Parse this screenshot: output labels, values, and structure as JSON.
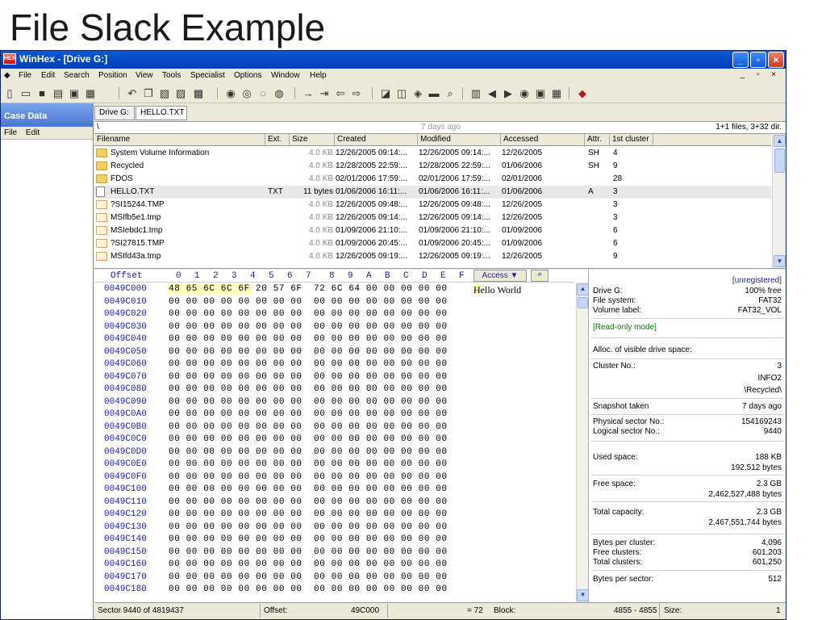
{
  "slide": {
    "title": "File Slack Example"
  },
  "window": {
    "title": "WinHex - [Drive G:]",
    "menu": [
      "File",
      "Edit",
      "Search",
      "Position",
      "View",
      "Tools",
      "Specialist",
      "Options",
      "Window",
      "Help"
    ],
    "mdi_controls": "_ ▫ ×"
  },
  "case_pane": {
    "title": "Case Data",
    "menu": [
      "File",
      "Edit"
    ]
  },
  "tabs": [
    "Drive G:",
    "HELLO.TXT"
  ],
  "path_bar": {
    "path": "\\",
    "age": "7 days ago",
    "summary": "1+1 files, 3+32 dir."
  },
  "file_table": {
    "columns": [
      "Filename",
      "Ext.",
      "Size",
      "Created",
      "Modified",
      "Accessed",
      "Attr.",
      "1st cluster"
    ],
    "rows": [
      {
        "name": "System Volume Information",
        "ext": "",
        "size": "4.0 KB",
        "created": "12/26/2005 09:14:...",
        "modified": "12/26/2005 09:14:...",
        "accessed": "12/26/2005",
        "attr": "SH",
        "cluster": "4",
        "icon": "folder"
      },
      {
        "name": "Recycled",
        "ext": "",
        "size": "4.0 KB",
        "created": "12/28/2005 22:59:...",
        "modified": "12/28/2005 22:59:...",
        "accessed": "01/06/2006",
        "attr": "SH",
        "cluster": "9",
        "icon": "folder"
      },
      {
        "name": "FDOS",
        "ext": "",
        "size": "4.0 KB",
        "created": "02/01/2006 17:59:...",
        "modified": "02/01/2006 17:59:...",
        "accessed": "02/01/2006",
        "attr": "",
        "cluster": "28",
        "icon": "folder"
      },
      {
        "name": "HELLO.TXT",
        "ext": "TXT",
        "size": "11 bytes",
        "created": "01/06/2006 16:11:...",
        "modified": "01/06/2006 16:11:...",
        "accessed": "01/06/2006",
        "attr": "A",
        "cluster": "3",
        "icon": "doc"
      },
      {
        "name": "?SI15244.TMP",
        "ext": "",
        "size": "4.0 KB",
        "created": "12/26/2005 09:48:...",
        "modified": "12/26/2005 09:48:...",
        "accessed": "12/26/2005",
        "attr": "",
        "cluster": "3",
        "icon": "tmp"
      },
      {
        "name": "MSIfb5e1.tmp",
        "ext": "",
        "size": "4.0 KB",
        "created": "12/26/2005 09:14:...",
        "modified": "12/26/2005 09:14:...",
        "accessed": "12/26/2005",
        "attr": "",
        "cluster": "3",
        "icon": "tmp"
      },
      {
        "name": "MSIebdc1.tmp",
        "ext": "",
        "size": "4.0 KB",
        "created": "01/09/2006 21:10:...",
        "modified": "01/09/2006 21:10:...",
        "accessed": "01/09/2006",
        "attr": "",
        "cluster": "6",
        "icon": "tmp"
      },
      {
        "name": "?SI27815.TMP",
        "ext": "",
        "size": "4.0 KB",
        "created": "01/09/2006 20:45:...",
        "modified": "01/09/2006 20:45:...",
        "accessed": "01/09/2006",
        "attr": "",
        "cluster": "6",
        "icon": "tmp"
      },
      {
        "name": "MSIfd43a.tmp",
        "ext": "",
        "size": "4.0 KB",
        "created": "12/26/2005 09:19:...",
        "modified": "12/26/2005 09:19:...",
        "accessed": "12/26/2005",
        "attr": "",
        "cluster": "9",
        "icon": "tmp"
      }
    ]
  },
  "hex_view": {
    "offset_label": "Offset",
    "column_headers": [
      "0",
      "1",
      "2",
      "3",
      "4",
      "5",
      "6",
      "7",
      "8",
      "9",
      "A",
      "B",
      "C",
      "D",
      "E",
      "F"
    ],
    "access_label": "Access ▼",
    "rows": [
      {
        "offset": "0049C000",
        "bytes": "48 65 6C 6C 6F 20 57 6F  72 6C 64 00 00 00 00 00",
        "ascii": "Hello World"
      },
      {
        "offset": "0049C010",
        "bytes": "00 00 00 00 00 00 00 00  00 00 00 00 00 00 00 00",
        "ascii": ""
      },
      {
        "offset": "0049C020",
        "bytes": "00 00 00 00 00 00 00 00  00 00 00 00 00 00 00 00",
        "ascii": ""
      },
      {
        "offset": "0049C030",
        "bytes": "00 00 00 00 00 00 00 00  00 00 00 00 00 00 00 00",
        "ascii": ""
      },
      {
        "offset": "0049C040",
        "bytes": "00 00 00 00 00 00 00 00  00 00 00 00 00 00 00 00",
        "ascii": ""
      },
      {
        "offset": "0049C050",
        "bytes": "00 00 00 00 00 00 00 00  00 00 00 00 00 00 00 00",
        "ascii": ""
      },
      {
        "offset": "0049C060",
        "bytes": "00 00 00 00 00 00 00 00  00 00 00 00 00 00 00 00",
        "ascii": ""
      },
      {
        "offset": "0049C070",
        "bytes": "00 00 00 00 00 00 00 00  00 00 00 00 00 00 00 00",
        "ascii": ""
      },
      {
        "offset": "0049C080",
        "bytes": "00 00 00 00 00 00 00 00  00 00 00 00 00 00 00 00",
        "ascii": ""
      },
      {
        "offset": "0049C090",
        "bytes": "00 00 00 00 00 00 00 00  00 00 00 00 00 00 00 00",
        "ascii": ""
      },
      {
        "offset": "0049C0A0",
        "bytes": "00 00 00 00 00 00 00 00  00 00 00 00 00 00 00 00",
        "ascii": ""
      },
      {
        "offset": "0049C0B0",
        "bytes": "00 00 00 00 00 00 00 00  00 00 00 00 00 00 00 00",
        "ascii": ""
      },
      {
        "offset": "0049C0C0",
        "bytes": "00 00 00 00 00 00 00 00  00 00 00 00 00 00 00 00",
        "ascii": ""
      },
      {
        "offset": "0049C0D0",
        "bytes": "00 00 00 00 00 00 00 00  00 00 00 00 00 00 00 00",
        "ascii": ""
      },
      {
        "offset": "0049C0E0",
        "bytes": "00 00 00 00 00 00 00 00  00 00 00 00 00 00 00 00",
        "ascii": ""
      },
      {
        "offset": "0049C0F0",
        "bytes": "00 00 00 00 00 00 00 00  00 00 00 00 00 00 00 00",
        "ascii": ""
      },
      {
        "offset": "0049C100",
        "bytes": "00 00 00 00 00 00 00 00  00 00 00 00 00 00 00 00",
        "ascii": ""
      },
      {
        "offset": "0049C110",
        "bytes": "00 00 00 00 00 00 00 00  00 00 00 00 00 00 00 00",
        "ascii": ""
      },
      {
        "offset": "0049C120",
        "bytes": "00 00 00 00 00 00 00 00  00 00 00 00 00 00 00 00",
        "ascii": ""
      },
      {
        "offset": "0049C130",
        "bytes": "00 00 00 00 00 00 00 00  00 00 00 00 00 00 00 00",
        "ascii": ""
      },
      {
        "offset": "0049C140",
        "bytes": "00 00 00 00 00 00 00 00  00 00 00 00 00 00 00 00",
        "ascii": ""
      },
      {
        "offset": "0049C150",
        "bytes": "00 00 00 00 00 00 00 00  00 00 00 00 00 00 00 00",
        "ascii": ""
      },
      {
        "offset": "0049C160",
        "bytes": "00 00 00 00 00 00 00 00  00 00 00 00 00 00 00 00",
        "ascii": ""
      },
      {
        "offset": "0049C170",
        "bytes": "00 00 00 00 00 00 00 00  00 00 00 00 00 00 00 00",
        "ascii": ""
      },
      {
        "offset": "0049C180",
        "bytes": "00 00 00 00 00 00 00 00  00 00 00 00 00 00 00 00",
        "ascii": ""
      }
    ]
  },
  "info_panel": {
    "registration": "[unregistered]",
    "drive_label": "Drive G:",
    "drive_free": "100% free",
    "fs_label": "File system:",
    "fs_value": "FAT32",
    "vol_label": "Volume label:",
    "vol_value": "FAT32_VOL",
    "mode": "[Read-only mode]",
    "alloc_label": "Alloc. of visible drive space:",
    "cluster_label": "Cluster No.:",
    "cluster_value": "3",
    "cluster_file": "INFO2",
    "cluster_path": "\\Recycled\\",
    "snapshot_label": "Snapshot taken",
    "snapshot_value": "7 days ago",
    "phys_label": "Physical sector No.:",
    "phys_value": "154169243",
    "logical_label": "Logical sector No.:",
    "logical_value": "9440",
    "used_label": "Used space:",
    "used_value": "188 KB",
    "used_bytes": "192,512 bytes",
    "free_label": "Free space:",
    "free_value": "2.3 GB",
    "free_bytes": "2,462,527,488 bytes",
    "total_label": "Total capacity:",
    "total_value": "2.3 GB",
    "total_bytes": "2,467,551,744 bytes",
    "bpc_label": "Bytes per cluster:",
    "bpc_value": "4,096",
    "fc_label": "Free clusters:",
    "fc_value": "601,203",
    "tc_label": "Total clusters:",
    "tc_value": "601,250",
    "bps_label": "Bytes per sector:",
    "bps_value": "512"
  },
  "status_bar": {
    "sector": "Sector 9440 of 4819437",
    "offset_label": "Offset:",
    "offset_value": "49C000",
    "value": "= 72",
    "block_label": "Block:",
    "block_value": "4855 - 4855",
    "size_label": "Size:",
    "size_value": "1"
  }
}
